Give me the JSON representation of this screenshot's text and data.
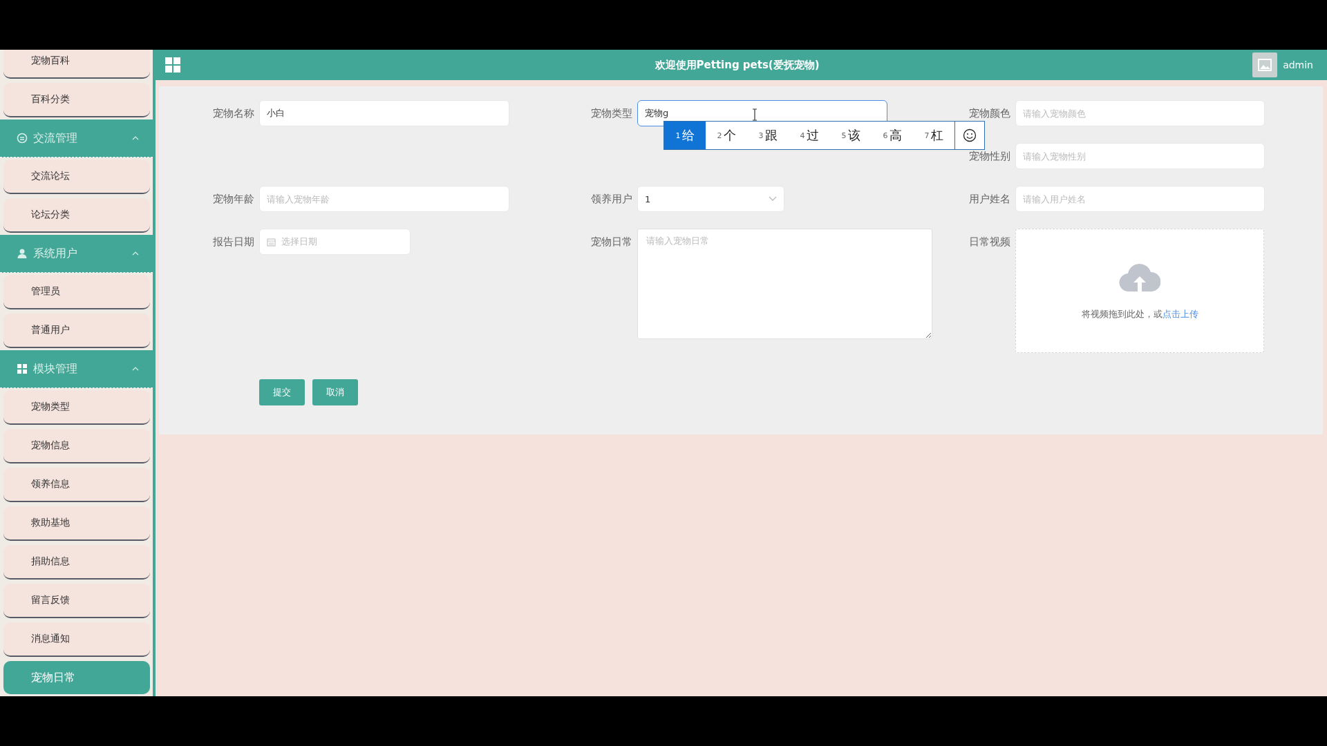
{
  "sidebar": [
    {
      "kind": "item",
      "label": "宠物百科",
      "selected": false
    },
    {
      "kind": "item",
      "label": "百科分类",
      "selected": false
    },
    {
      "kind": "group",
      "label": "交流管理",
      "expanded": true
    },
    {
      "kind": "item",
      "label": "交流论坛",
      "selected": false
    },
    {
      "kind": "item",
      "label": "论坛分类",
      "selected": false
    },
    {
      "kind": "group",
      "label": "系统用户",
      "expanded": true
    },
    {
      "kind": "item",
      "label": "管理员",
      "selected": false
    },
    {
      "kind": "item",
      "label": "普通用户",
      "selected": false
    },
    {
      "kind": "group",
      "label": "模块管理",
      "expanded": true
    },
    {
      "kind": "item",
      "label": "宠物类型",
      "selected": false
    },
    {
      "kind": "item",
      "label": "宠物信息",
      "selected": false
    },
    {
      "kind": "item",
      "label": "领养信息",
      "selected": false
    },
    {
      "kind": "item",
      "label": "救助基地",
      "selected": false
    },
    {
      "kind": "item",
      "label": "捐助信息",
      "selected": false
    },
    {
      "kind": "item",
      "label": "留言反馈",
      "selected": false
    },
    {
      "kind": "item",
      "label": "消息通知",
      "selected": false
    },
    {
      "kind": "item",
      "label": "宠物日常",
      "selected": true
    }
  ],
  "header": {
    "title": "欢迎使用Petting pets(爱抚宠物)",
    "user": "admin"
  },
  "form": {
    "fields": [
      {
        "kind": "text",
        "label": "宠物名称",
        "value": "小白",
        "focused": false
      },
      {
        "kind": "text",
        "label": "宠物类型",
        "value": "宠物g",
        "focused": true
      },
      {
        "kind": "text",
        "label": "宠物颜色",
        "placeholder": "请输入宠物颜色",
        "focused": false
      },
      {
        "kind": "text",
        "label": "宠物性别",
        "placeholder": "请输入宠物性别",
        "focused": false
      },
      {
        "kind": "text",
        "label": "宠物年龄",
        "placeholder": "请输入宠物年龄",
        "focused": false
      },
      {
        "kind": "select",
        "label": "领养用户",
        "value": "1"
      },
      {
        "kind": "text",
        "label": "用户姓名",
        "placeholder": "请输入用户姓名",
        "focused": false
      },
      {
        "kind": "date",
        "label": "报告日期",
        "placeholder": "选择日期"
      },
      {
        "kind": "textarea",
        "label": "宠物日常",
        "placeholder": "请输入宠物日常"
      },
      {
        "kind": "upload",
        "label": "日常视频",
        "hint": "将视频拖到此处，或",
        "link": "点击上传"
      }
    ],
    "buttons": [
      "提交",
      "取消"
    ]
  },
  "ime": {
    "candidates": [
      {
        "number": "1",
        "text": "给",
        "selected": true
      },
      {
        "number": "2",
        "text": "个",
        "selected": false
      },
      {
        "number": "3",
        "text": "跟",
        "selected": false
      },
      {
        "number": "4",
        "text": "过",
        "selected": false
      },
      {
        "number": "5",
        "text": "该",
        "selected": false
      },
      {
        "number": "6",
        "text": "高",
        "selected": false
      },
      {
        "number": "7",
        "text": "杠",
        "selected": false
      }
    ]
  }
}
